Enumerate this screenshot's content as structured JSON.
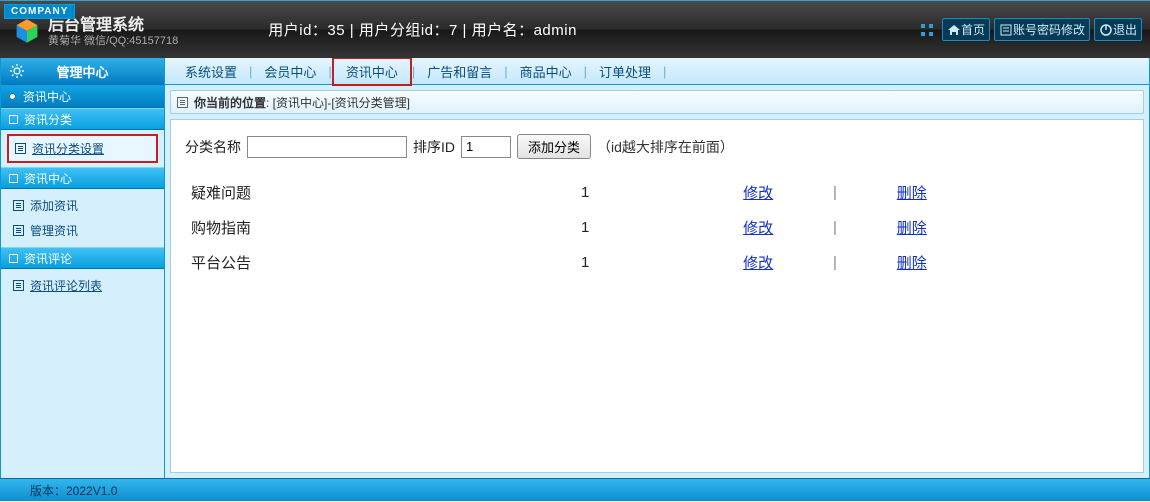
{
  "company_tag": "COMPANY",
  "header": {
    "title": "后台管理系统",
    "subtitle": "黄菊华 微信/QQ:45157718",
    "user_info": "用户id：35 | 用户分组id：7 | 用户名：admin",
    "actions": {
      "home": "首页",
      "pw": "账号密码修改",
      "exit": "退出"
    }
  },
  "sidebar": {
    "top": "管理中心",
    "sub": "资讯中心",
    "groups": [
      {
        "head": "资讯分类",
        "items": [
          {
            "label": "资讯分类设置",
            "hl": true
          }
        ]
      },
      {
        "head": "资讯中心",
        "items": [
          {
            "label": "添加资讯"
          },
          {
            "label": "管理资讯"
          }
        ]
      },
      {
        "head": "资讯评论",
        "items": [
          {
            "label": "资讯评论列表",
            "link": true
          }
        ]
      }
    ]
  },
  "tabs": [
    "系统设置",
    "会员中心",
    "资讯中心",
    "广告和留言",
    "商品中心",
    "订单处理"
  ],
  "tab_hl_index": 2,
  "crumb": {
    "prefix": "你当前的位置",
    "path": " : [资讯中心]-[资讯分类管理]"
  },
  "form": {
    "name_label": "分类名称",
    "name_val": "",
    "sort_label": "排序ID",
    "sort_val": "1",
    "add_btn": "添加分类",
    "note": "（id越大排序在前面）"
  },
  "rows": [
    {
      "name": "疑难问题",
      "sort": "1",
      "edit": "修改",
      "del": "删除"
    },
    {
      "name": "购物指南",
      "sort": "1",
      "edit": "修改",
      "del": "删除"
    },
    {
      "name": "平台公告",
      "sort": "1",
      "edit": "修改",
      "del": "删除"
    }
  ],
  "footer": "版本：2022V1.0"
}
